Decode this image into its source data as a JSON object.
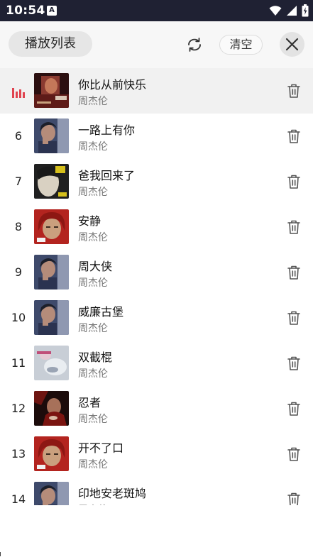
{
  "status_bar": {
    "time": "10:54",
    "notification_icon": "A",
    "icons": [
      "wifi-icon",
      "signal-icon",
      "battery-icon"
    ]
  },
  "header": {
    "title": "播放列表",
    "repeat_icon": "repeat-icon",
    "clear_label": "清空",
    "close_icon": "close-icon"
  },
  "colors": {
    "accent": "#e0434f",
    "header_bg": "#f7f7f7",
    "active_row_bg": "#f1f1f1",
    "status_bar_bg": "#1f2133"
  },
  "songs": [
    {
      "index": "",
      "title": "你比从前快乐",
      "artist": "周杰伦",
      "playing": true,
      "cover": "cover-fantasy"
    },
    {
      "index": "6",
      "title": "一路上有你",
      "artist": "周杰伦",
      "playing": false,
      "cover": "cover-portrait-blue"
    },
    {
      "index": "7",
      "title": "爸我回来了",
      "artist": "周杰伦",
      "playing": false,
      "cover": "cover-jay-yellow"
    },
    {
      "index": "8",
      "title": "安静",
      "artist": "周杰伦",
      "playing": false,
      "cover": "cover-red-hood"
    },
    {
      "index": "9",
      "title": "周大侠",
      "artist": "周杰伦",
      "playing": false,
      "cover": "cover-portrait-blue"
    },
    {
      "index": "10",
      "title": "威廉古堡",
      "artist": "周杰伦",
      "playing": false,
      "cover": "cover-portrait-blue"
    },
    {
      "index": "11",
      "title": "双截棍",
      "artist": "周杰伦",
      "playing": false,
      "cover": "cover-light-flowers"
    },
    {
      "index": "12",
      "title": "忍者",
      "artist": "周杰伦",
      "playing": false,
      "cover": "cover-dark-red"
    },
    {
      "index": "13",
      "title": "开不了口",
      "artist": "周杰伦",
      "playing": false,
      "cover": "cover-red-hood"
    },
    {
      "index": "14",
      "title": "印地安老斑鸠",
      "artist": "周杰伦",
      "playing": false,
      "cover": "cover-portrait-blue"
    }
  ]
}
